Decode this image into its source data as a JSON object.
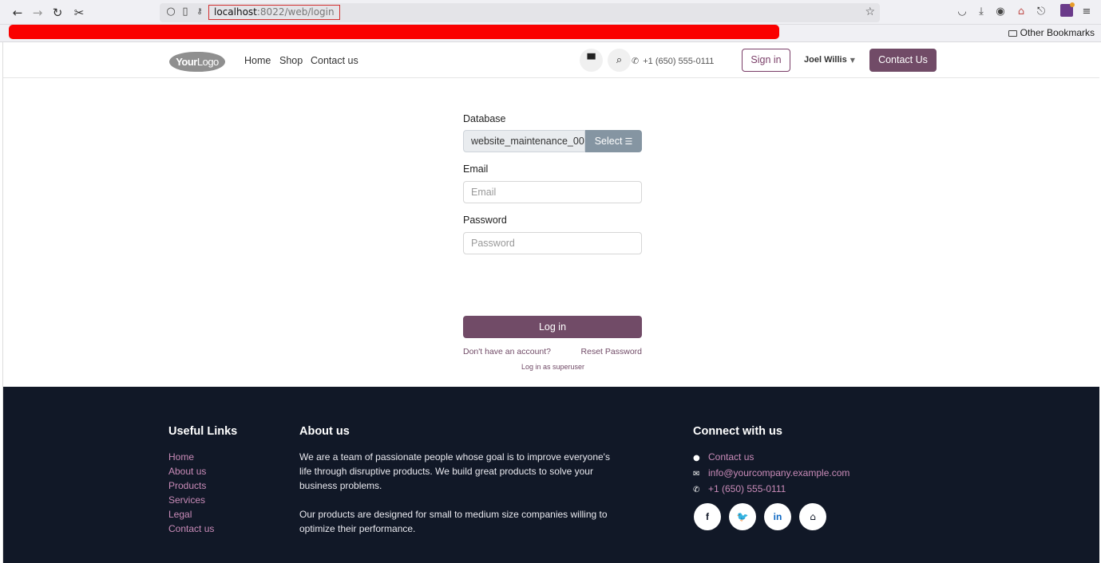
{
  "browser": {
    "url_host": "localhost",
    "url_path": ":8022/web/login",
    "bookmarks": {
      "other_label": "Other Bookmarks"
    }
  },
  "header": {
    "logo_bold": "Your",
    "logo_light": "Logo",
    "nav": [
      "Home",
      "Shop",
      "Contact us"
    ],
    "phone": "+1 (650) 555-0111",
    "sign_in": "Sign in",
    "user": "Joel Willis",
    "contact_button": "Contact Us"
  },
  "login": {
    "database_label": "Database",
    "database_value": "website_maintenance_00",
    "select_label": "Select",
    "email_label": "Email",
    "email_placeholder": "Email",
    "password_label": "Password",
    "password_placeholder": "Password",
    "login_button": "Log in",
    "signup_link": "Don't have an account?",
    "reset_link": "Reset Password",
    "superuser_link": "Log in as superuser"
  },
  "footer": {
    "useful_links_title": "Useful Links",
    "useful_links": [
      "Home",
      "About us",
      "Products",
      "Services",
      "Legal",
      "Contact us"
    ],
    "about_title": "About us",
    "about_p1": "We are a team of passionate people whose goal is to improve everyone's life through disruptive products. We build great products to solve your business problems.",
    "about_p2": "Our products are designed for small to medium size companies willing to optimize their performance.",
    "connect_title": "Connect with us",
    "contact_us": "Contact us",
    "email": "info@yourcompany.example.com",
    "phone": "+1 (650) 555-0111",
    "social": {
      "facebook": "f",
      "linkedin": "in"
    }
  },
  "colors": {
    "brand": "#714b67",
    "footer_bg": "#111827",
    "footer_link": "#c98bb8",
    "redaction": "#fa0000"
  }
}
